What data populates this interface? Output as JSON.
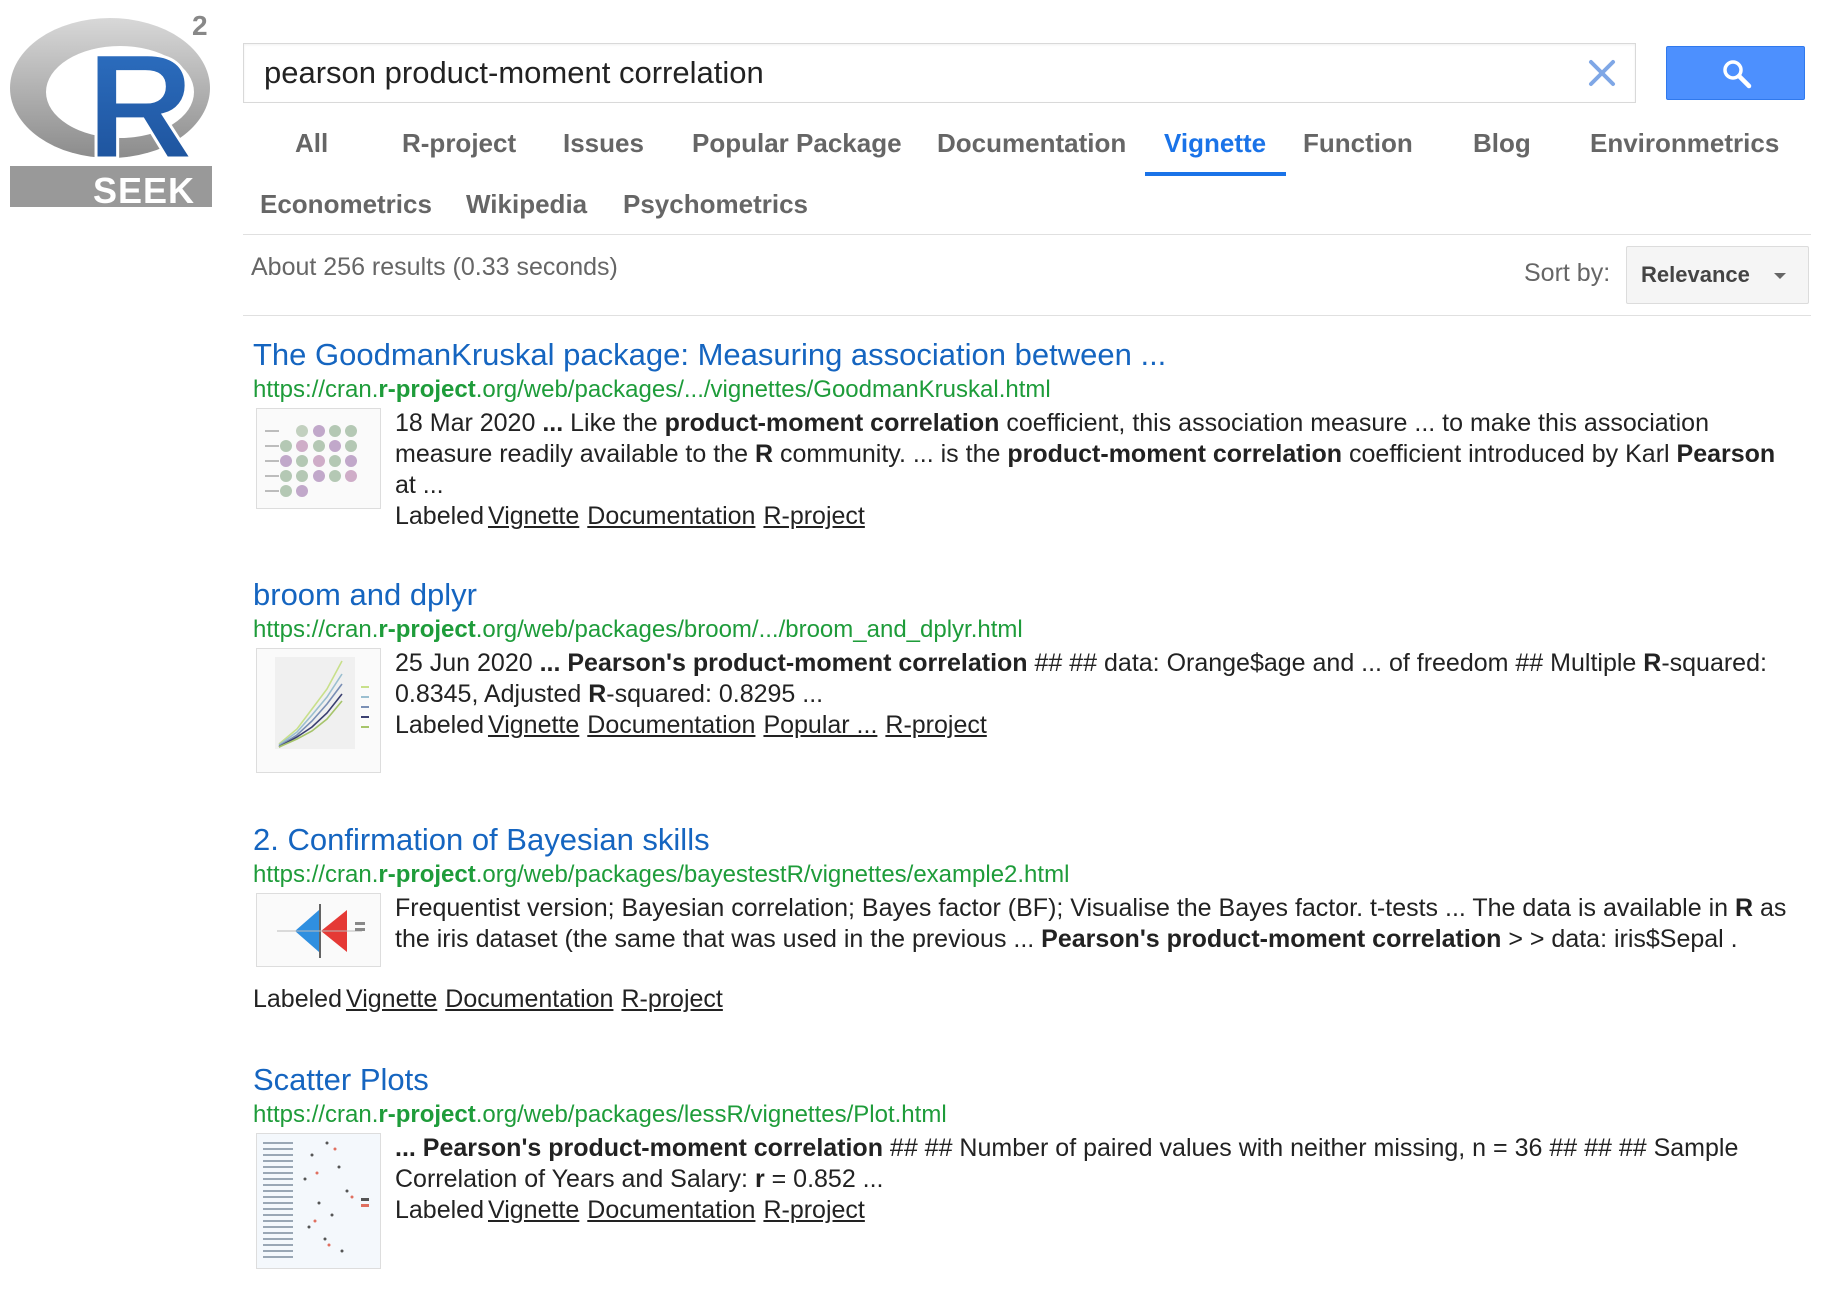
{
  "brand": {
    "logo_text": "SEEK",
    "logo_letter": "R",
    "logo_superscript": "2"
  },
  "search": {
    "query": "pearson product-moment correlation",
    "clear_icon": "close-icon",
    "submit_icon": "search-icon"
  },
  "tabs": [
    {
      "label": "All",
      "active": false
    },
    {
      "label": "R-project",
      "active": false
    },
    {
      "label": "Issues",
      "active": false
    },
    {
      "label": "Popular Package",
      "active": false
    },
    {
      "label": "Documentation",
      "active": false
    },
    {
      "label": "Vignette",
      "active": true
    },
    {
      "label": "Function",
      "active": false
    },
    {
      "label": "Blog",
      "active": false
    },
    {
      "label": "Environmetrics",
      "active": false
    },
    {
      "label": "Econometrics",
      "active": false
    },
    {
      "label": "Wikipedia",
      "active": false
    },
    {
      "label": "Psychometrics",
      "active": false
    }
  ],
  "stats": "About 256 results (0.33 seconds)",
  "sort": {
    "label": "Sort by:",
    "value": "Relevance"
  },
  "colors": {
    "accent": "#1a73e8",
    "link": "#1565c0",
    "url": "#1e9c3a",
    "search_button": "#4d90fe"
  },
  "labeled_prefix": "Labeled",
  "results": [
    {
      "title": "The GoodmanKruskal package: Measuring association between ...",
      "url_pre": "https://cran.",
      "url_bold": "r-project",
      "url_post": ".org/web/packages/.../vignettes/GoodmanKruskal.html",
      "snippet_parts": [
        {
          "t": "18 Mar 2020 ",
          "b": false
        },
        {
          "t": "...",
          "b": true
        },
        {
          "t": " Like the ",
          "b": false
        },
        {
          "t": "product-moment correlation",
          "b": true
        },
        {
          "t": " coefficient, this association measure ... to make this association measure readily available to the ",
          "b": false
        },
        {
          "t": "R",
          "b": true
        },
        {
          "t": " community. ... is the ",
          "b": false
        },
        {
          "t": "product-moment correlation",
          "b": true
        },
        {
          "t": " coefficient introduced by Karl ",
          "b": false
        },
        {
          "t": "Pearson",
          "b": true
        },
        {
          "t": " at ...",
          "b": false
        }
      ],
      "labels": [
        "Vignette",
        "Documentation",
        "R-project"
      ]
    },
    {
      "title": "broom and dplyr",
      "url_pre": "https://cran.",
      "url_bold": "r-project",
      "url_post": ".org/web/packages/broom/.../broom_and_dplyr.html",
      "snippet_parts": [
        {
          "t": "25 Jun 2020 ",
          "b": false
        },
        {
          "t": "... Pearson's product-moment correlation",
          "b": true
        },
        {
          "t": " ## ## data: Orange$age and ... of freedom ## Multiple ",
          "b": false
        },
        {
          "t": "R",
          "b": true
        },
        {
          "t": "-squared: 0.8345, Adjusted ",
          "b": false
        },
        {
          "t": "R",
          "b": true
        },
        {
          "t": "-squared: 0.8295 ...",
          "b": false
        }
      ],
      "labels": [
        "Vignette",
        "Documentation",
        "Popular ...",
        "R-project"
      ]
    },
    {
      "title": "2. Confirmation of Bayesian skills",
      "url_pre": "https://cran.",
      "url_bold": "r-project",
      "url_post": ".org/web/packages/bayestestR/vignettes/example2.html",
      "snippet_parts": [
        {
          "t": "Frequentist version; Bayesian correlation; Bayes factor (BF); Visualise the Bayes factor. t-tests ... The data is available in ",
          "b": false
        },
        {
          "t": "R",
          "b": true
        },
        {
          "t": " as the iris dataset (the same that was used in the previous ... ",
          "b": false
        },
        {
          "t": "Pearson's product-moment correlation",
          "b": true
        },
        {
          "t": " > > data: iris$Sepal .",
          "b": false
        }
      ],
      "labels": [
        "Vignette",
        "Documentation",
        "R-project"
      ]
    },
    {
      "title": "Scatter Plots",
      "url_pre": "https://cran.",
      "url_bold": "r-project",
      "url_post": ".org/web/packages/lessR/vignettes/Plot.html",
      "snippet_parts": [
        {
          "t": "... Pearson's product-moment correlation",
          "b": true
        },
        {
          "t": " ## ## Number of paired values with neither missing, n = 36 ## ## ## Sample Correlation of Years and Salary: ",
          "b": false
        },
        {
          "t": "r",
          "b": true
        },
        {
          "t": " = 0.852 ...",
          "b": false
        }
      ],
      "labels": [
        "Vignette",
        "Documentation",
        "R-project"
      ]
    }
  ]
}
